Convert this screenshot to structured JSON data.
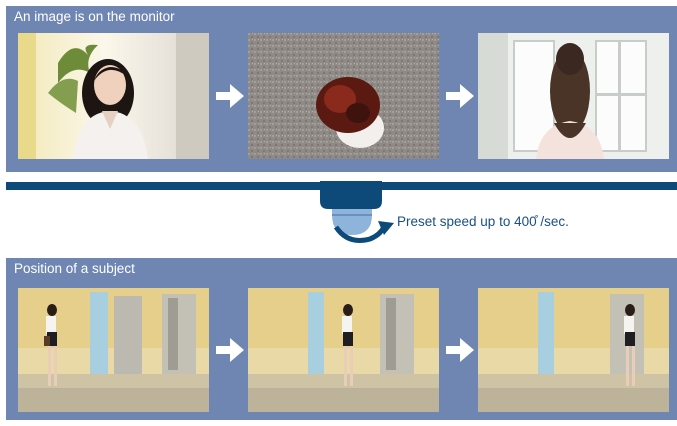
{
  "top_panel": {
    "title": "An image is on the monitor"
  },
  "camera": {
    "speed_text": "Preset speed up to 400̊ /sec."
  },
  "bottom_panel": {
    "title": "Position of a subject"
  },
  "colors": {
    "panel": "#6f86b3",
    "divider": "#0d4a7a",
    "camera_body": "#8fb4dc",
    "speed_text": "#1a4f86"
  }
}
